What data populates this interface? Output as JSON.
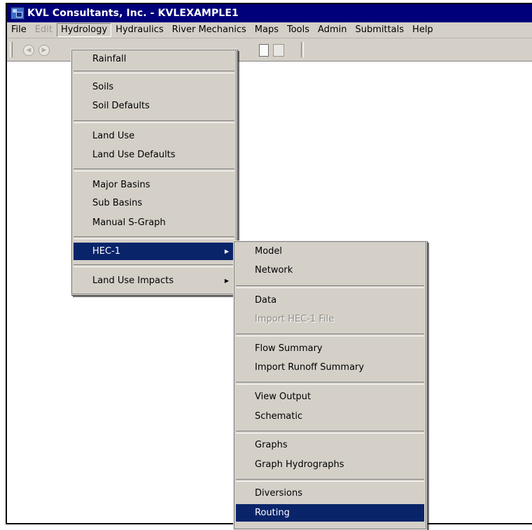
{
  "window": {
    "title": "KVL Consultants, Inc. - KVLEXAMPLE1"
  },
  "menubar": {
    "items": [
      {
        "label": "File"
      },
      {
        "label": "Edit"
      },
      {
        "label": "Hydrology"
      },
      {
        "label": "Hydraulics"
      },
      {
        "label": "River Mechanics"
      },
      {
        "label": "Maps"
      },
      {
        "label": "Tools"
      },
      {
        "label": "Admin"
      },
      {
        "label": "Submittals"
      },
      {
        "label": "Help"
      }
    ]
  },
  "toolbar": {
    "icons": [
      "back-icon",
      "forward-icon",
      "new-document-icon",
      "document-icon"
    ]
  },
  "hydrology_menu": {
    "items": [
      {
        "label": "Rainfall"
      },
      {
        "label": "Soils"
      },
      {
        "label": "Soil Defaults"
      },
      {
        "label": "Land Use"
      },
      {
        "label": "Land Use Defaults"
      },
      {
        "label": "Major Basins"
      },
      {
        "label": "Sub Basins"
      },
      {
        "label": "Manual S-Graph"
      },
      {
        "label": "HEC-1"
      },
      {
        "label": "Land Use Impacts"
      }
    ]
  },
  "hec1_menu": {
    "items": [
      {
        "label": "Model"
      },
      {
        "label": "Network"
      },
      {
        "label": "Data"
      },
      {
        "label": "Import HEC-1 File"
      },
      {
        "label": "Flow Summary"
      },
      {
        "label": "Import Runoff Summary"
      },
      {
        "label": "View Output"
      },
      {
        "label": "Schematic"
      },
      {
        "label": "Graphs"
      },
      {
        "label": "Graph Hydrographs"
      },
      {
        "label": "Diversions"
      },
      {
        "label": "Routing"
      }
    ]
  },
  "colors": {
    "titlebar": "#00007a",
    "highlight": "#0a246a",
    "face": "#d4d0c8"
  }
}
